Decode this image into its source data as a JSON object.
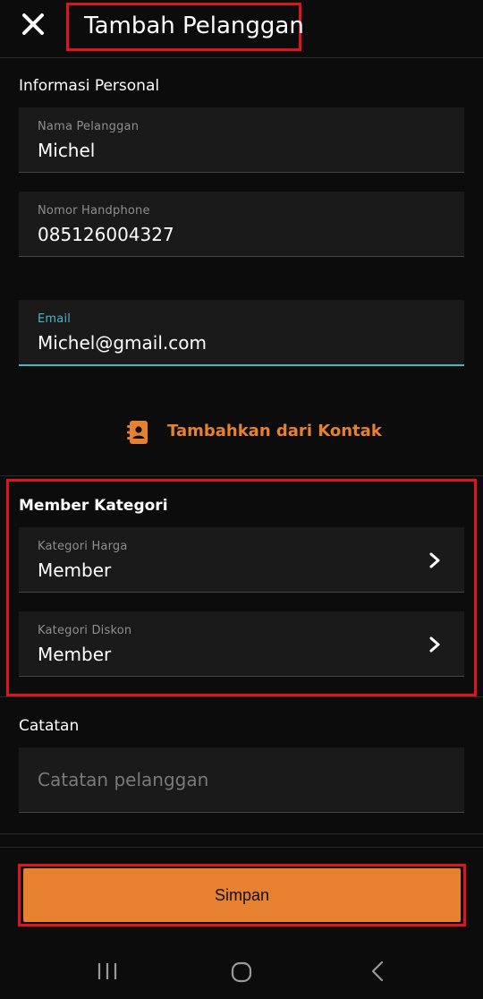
{
  "header": {
    "title": "Tambah Pelanggan",
    "close_icon": "close-icon"
  },
  "personal": {
    "section_title": "Informasi Personal",
    "name": {
      "label": "Nama Pelanggan",
      "value": "Michel"
    },
    "phone": {
      "label": "Nomor Handphone",
      "value": "085126004327"
    },
    "email": {
      "label": "Email",
      "value": "Michel@gmail.com"
    }
  },
  "contacts": {
    "label": "Tambahkan dari Kontak",
    "icon": "contact-book-icon"
  },
  "member": {
    "section_title": "Member Kategori",
    "price": {
      "label": "Kategori Harga",
      "value": "Member"
    },
    "discount": {
      "label": "Kategori Diskon",
      "value": "Member"
    }
  },
  "notes": {
    "section_title": "Catatan",
    "placeholder": "Catatan pelanggan"
  },
  "actions": {
    "save_label": "Simpan"
  },
  "colors": {
    "accent": "#e6822f",
    "focus": "#4db6c6",
    "highlight": "#e0141e",
    "background": "#0c0c0c",
    "field": "#1a1a1a"
  },
  "system_nav": {
    "recent": "recent-apps-icon",
    "home": "home-icon",
    "back": "back-icon"
  }
}
